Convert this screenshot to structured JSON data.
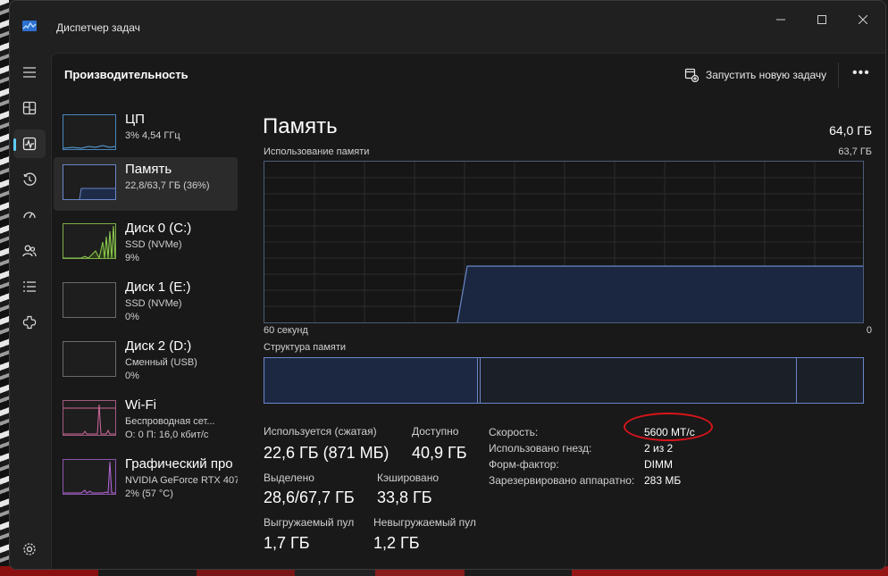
{
  "window": {
    "title": "Диспетчер задач"
  },
  "header": {
    "title": "Производительность",
    "run_task_label": "Запустить новую задачу",
    "more_label": "•••"
  },
  "rail": {
    "icons": [
      "hamburger-icon",
      "processes-icon",
      "performance-icon",
      "app-history-icon",
      "startup-apps-icon",
      "users-icon",
      "details-icon",
      "services-icon",
      "settings-icon"
    ]
  },
  "list": [
    {
      "name": "ЦП",
      "sub1": "3% 4,54 ГГц",
      "sub2": ""
    },
    {
      "name": "Память",
      "sub1": "22,8/63,7 ГБ (36%)",
      "sub2": ""
    },
    {
      "name": "Диск 0 (C:)",
      "sub1": "SSD (NVMe)",
      "sub2": "9%"
    },
    {
      "name": "Диск 1 (E:)",
      "sub1": "SSD (NVMe)",
      "sub2": "0%"
    },
    {
      "name": "Диск 2 (D:)",
      "sub1": "Сменный (USB)",
      "sub2": "0%"
    },
    {
      "name": "Wi-Fi",
      "sub1": "Беспроводная сет...",
      "sub2": "О: 0 П: 16,0 кбит/с"
    },
    {
      "name": "Графический про",
      "sub1": "NVIDIA GeForce RTX 407",
      "sub2": "2% (57 °C)"
    }
  ],
  "memory": {
    "title": "Память",
    "total": "64,0 ГБ",
    "usage_label": "Использование памяти",
    "usage_max": "63,7 ГБ",
    "x_left": "60 секунд",
    "x_right": "0",
    "structure_label": "Структура памяти"
  },
  "stats": {
    "in_use_label": "Используется (сжатая)",
    "in_use": "22,6 ГБ (871 МБ)",
    "available_label": "Доступно",
    "available": "40,9 ГБ",
    "committed_label": "Выделено",
    "committed": "28,6/67,7 ГБ",
    "cached_label": "Кэшировано",
    "cached": "33,8 ГБ",
    "paged_label": "Выгружаемый пул",
    "paged": "1,7 ГБ",
    "nonpaged_label": "Невыгружаемый пул",
    "nonpaged": "1,2 ГБ"
  },
  "props": [
    {
      "k": "Скорость:",
      "v": "5600 МТ/с"
    },
    {
      "k": "Использовано гнезд:",
      "v": "2 из 2"
    },
    {
      "k": "Форм-фактор:",
      "v": "DIMM"
    },
    {
      "k": "Зарезервировано аппаратно:",
      "v": "283 МБ"
    }
  ],
  "colors": {
    "accent": "#60cdff",
    "memory": "#6a86c8",
    "disk": "#8fd14f",
    "network": "#d06a9b",
    "gpu": "#b469d6",
    "cpu": "#5aa9e6",
    "highlight": "#d8141b"
  }
}
